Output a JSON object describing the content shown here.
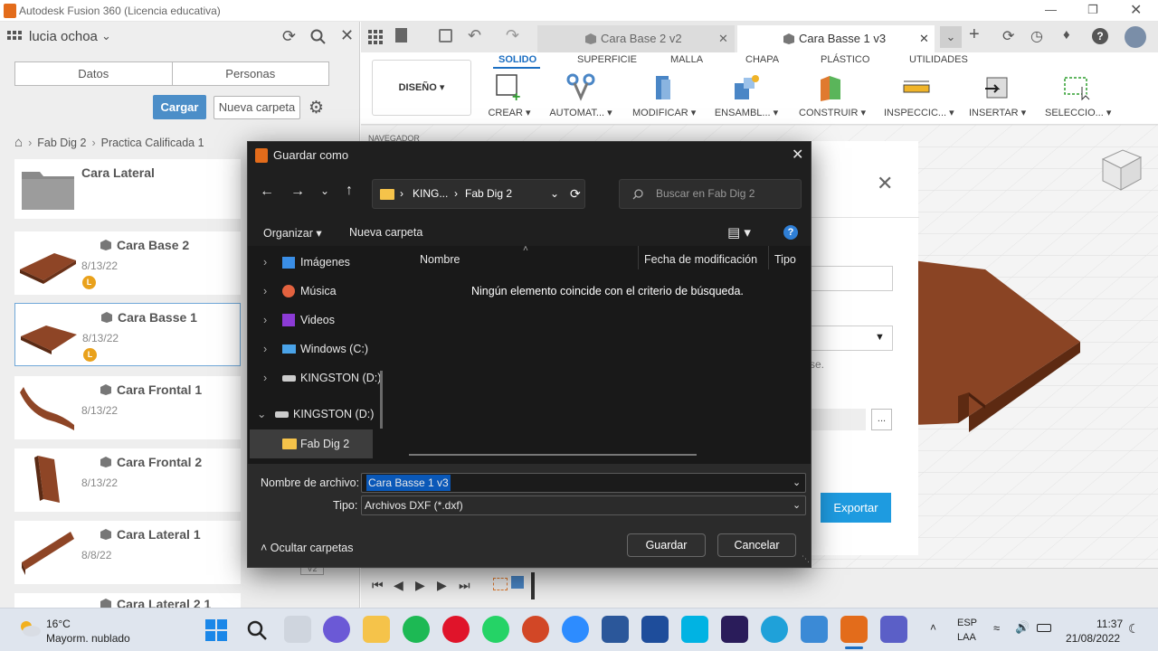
{
  "window": {
    "title": "Autodesk Fusion 360 (Licencia educativa)"
  },
  "left_panel": {
    "user": "lucia ochoa",
    "segment_tabs": [
      "Datos",
      "Personas"
    ],
    "upload_label": "Cargar",
    "new_folder_label": "Nueva carpeta",
    "breadcrumb": [
      "Fab Dig 2",
      "Practica Calificada 1"
    ],
    "items": [
      {
        "name": "Cara Lateral",
        "date": "",
        "badge": ""
      },
      {
        "name": "Cara Base 2",
        "date": "8/13/22",
        "badge": "L"
      },
      {
        "name": "Cara Basse 1",
        "date": "8/13/22",
        "badge": "L"
      },
      {
        "name": "Cara Frontal 1",
        "date": "8/13/22",
        "badge": ""
      },
      {
        "name": "Cara Frontal 2",
        "date": "8/13/22",
        "badge": ""
      },
      {
        "name": "Cara Lateral 1",
        "date": "8/8/22",
        "badge": ""
      },
      {
        "name": "Cara Lateral 2 1",
        "date": "",
        "badge": ""
      }
    ],
    "version_badge": "V2"
  },
  "doc_tabs": [
    {
      "label": "Cara Base 2 v2",
      "active": false
    },
    {
      "label": "Cara Basse 1 v3",
      "active": true
    }
  ],
  "toolbar": {
    "workspace": "DISEÑO",
    "tabs": [
      "SOLIDO",
      "SUPERFICIE",
      "MALLA",
      "CHAPA",
      "PLÁSTICO",
      "UTILIDADES"
    ],
    "active_tab": "SOLIDO",
    "groups": [
      "CREAR",
      "AUTOMAT...",
      "MODIFICAR",
      "ENSAMBL...",
      "CONSTRUIR",
      "INSPECCIC...",
      "INSERTAR",
      "SELECCIO..."
    ]
  },
  "browser_label": "NAVEGADOR",
  "export_dialog": {
    "export_label": "Exportar",
    "hint_text": "se.",
    "browse_label": "..."
  },
  "save_dialog": {
    "title": "Guardar como",
    "address": [
      "KING...",
      "Fab Dig 2"
    ],
    "search_placeholder": "Buscar en Fab Dig 2",
    "organize_label": "Organizar",
    "new_folder_label": "Nueva carpeta",
    "tree": [
      {
        "label": "Imágenes",
        "icon": "pictures-icon",
        "color": "#3a8ee6"
      },
      {
        "label": "Música",
        "icon": "music-icon",
        "color": "#e3623f"
      },
      {
        "label": "Videos",
        "icon": "videos-icon",
        "color": "#8c3bd6"
      },
      {
        "label": "Windows (C:)",
        "icon": "drive-icon",
        "color": "#4aa3e8"
      },
      {
        "label": "KINGSTON (D:)",
        "icon": "usb-drive-icon",
        "color": "#cccccc"
      },
      {
        "label": "KINGSTON (D:)",
        "icon": "usb-drive-icon",
        "color": "#cccccc"
      },
      {
        "label": "Fab Dig 2",
        "icon": "folder-icon",
        "color": "#f5c34a"
      }
    ],
    "columns": [
      "Nombre",
      "Fecha de modificación",
      "Tipo"
    ],
    "empty_message": "Ningún elemento coincide con el criterio de búsqueda.",
    "filename_label": "Nombre de archivo:",
    "filename_value": "Cara Basse 1 v3",
    "type_label": "Tipo:",
    "type_value": "Archivos DXF (*.dxf)",
    "hide_folders_label": "Ocultar carpetas",
    "save_label": "Guardar",
    "cancel_label": "Cancelar"
  },
  "taskbar": {
    "weather_temp": "16°C",
    "weather_text": "Mayorm. nublado",
    "lang_top": "ESP",
    "lang_bottom": "LAA",
    "time": "11:37",
    "date": "21/08/2022"
  }
}
